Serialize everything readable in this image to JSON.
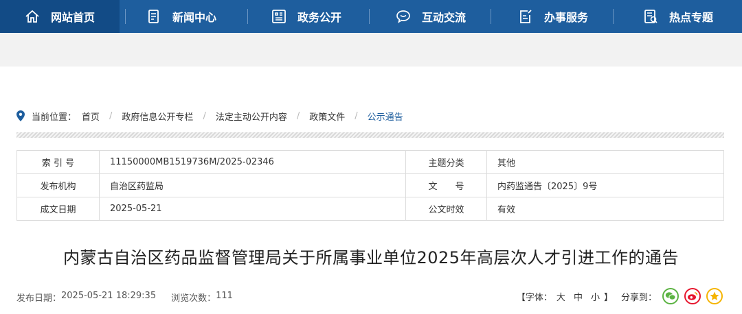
{
  "nav": {
    "items": [
      {
        "label": "网站首页",
        "icon": "home-icon"
      },
      {
        "label": "新闻中心",
        "icon": "news-icon"
      },
      {
        "label": "政务公开",
        "icon": "building-icon"
      },
      {
        "label": "互动交流",
        "icon": "chat-icon"
      },
      {
        "label": "办事服务",
        "icon": "edit-doc-icon"
      },
      {
        "label": "热点专题",
        "icon": "topic-icon"
      }
    ],
    "bg_color": "#1e5e9e",
    "active_color": "#124b86"
  },
  "breadcrumb": {
    "prefix": "当前位置：",
    "items": [
      "首页",
      "政府信息公开专栏",
      "法定主动公开内容",
      "政策文件"
    ],
    "separator": "/",
    "current": "公示通告"
  },
  "info": {
    "rows": [
      {
        "l1": "索 引 号",
        "v1": "11150000MB1519736M/2025-02346",
        "l2": "主题分类",
        "v2": "其他"
      },
      {
        "l1": "发布机构",
        "v1": "自治区药监局",
        "l2": "文　　号",
        "v2": "内药监通告〔2025〕9号"
      },
      {
        "l1": "成文日期",
        "v1": "2025-05-21",
        "l2": "公文时效",
        "v2": "有效"
      }
    ]
  },
  "article": {
    "title": "内蒙古自治区药品监督管理局关于所属事业单位2025年高层次人才引进工作的通告",
    "publish_label": "发布日期：",
    "publish_date": "2025-05-21 18:29:35",
    "views_label": "浏览次数：",
    "views": "111"
  },
  "tools": {
    "font_label": "【字体：",
    "sizes": [
      "大",
      "中",
      "小"
    ],
    "font_close": "】",
    "share_label": "分享到：",
    "share_icons": [
      "wechat-icon",
      "weibo-icon",
      "qzone-icon"
    ]
  }
}
